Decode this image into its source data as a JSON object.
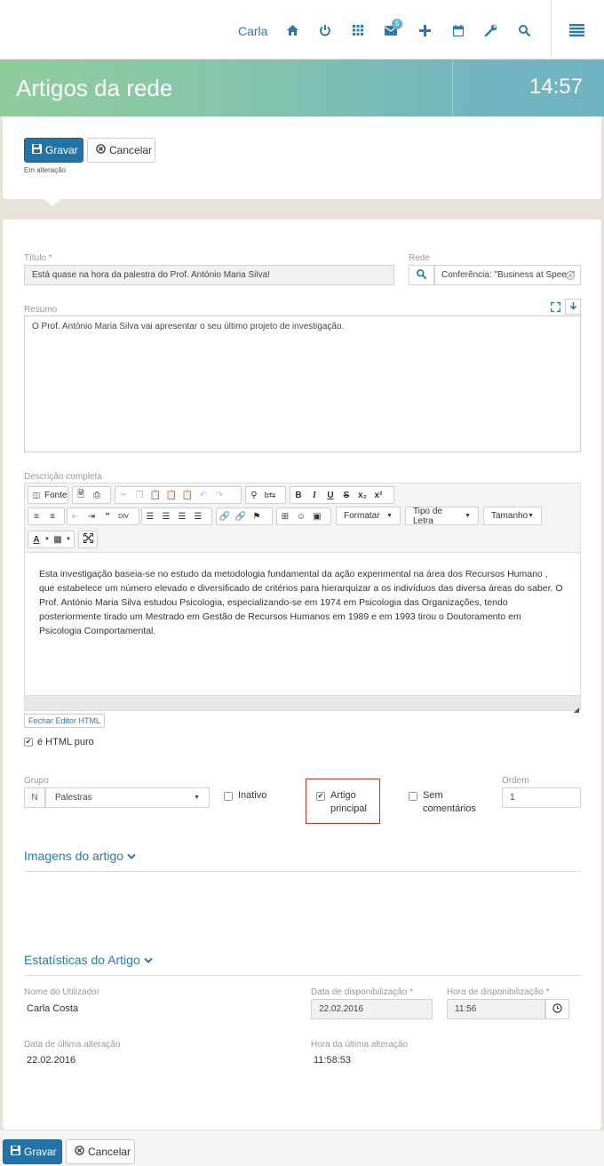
{
  "nav": {
    "user": "Carla",
    "badge_count": "5",
    "icons": [
      "home-icon",
      "power-icon",
      "grid-icon",
      "envelope-icon",
      "plus-icon",
      "calendar-icon",
      "wrench-icon",
      "search-icon",
      "menu-icon"
    ]
  },
  "banner": {
    "title": "Artigos da rede",
    "time": "14:57"
  },
  "actions": {
    "save": "Gravar",
    "cancel": "Cancelar",
    "status": "Em alteração"
  },
  "form": {
    "titulo_label": "Título *",
    "titulo_value": "Está quase na hora da palestra do Prof. António Maria Silva!",
    "rede_label": "Rede",
    "rede_value": "Conferência: \"Business at Speed\"",
    "resumo_label": "Resumo",
    "resumo_value": "O Prof. António Maria Silva vai apresentar o seu último projeto de investigação.",
    "descricao_label": "Descrição completa",
    "editor": {
      "fonte": "Fonte",
      "formatar": "Formatar",
      "tipo_letra": "Tipo de Letra",
      "tamanho": "Tamanho",
      "content": "Esta investigação baseia-se no estudo da metodologia fundamental da ação experimental na área dos Recursos Humano , que estabelece um número elevado e diversificado de critérios para hierarquizar a os indivíduos das diversa áreas do saber. O Prof. António Maria Silva estudou Psicologia, especializando-se em 1974 em Psicologia das Organizações, tendo posteriormente tirado um Mestrado em Gestão de Recursos Humanos em 1989 e em 1993 tirou o Doutoramento em Psicologia Comportamental."
    },
    "fechar_editor": "Fechar Editor HTML",
    "html_puro": "é HTML puro",
    "grupo_label": "Grupo",
    "grupo_prefix": "N",
    "grupo_value": "Palestras",
    "inativo": "Inativo",
    "artigo_principal_1": "Artigo",
    "artigo_principal_2": "principal",
    "sem_comentarios_1": "Sem",
    "sem_comentarios_2": "comentários",
    "ordem_label": "Ordem",
    "ordem_value": "1"
  },
  "imagens": {
    "title": "Imagens do artigo"
  },
  "estatisticas": {
    "title": "Estatísticas do Artigo",
    "nome_label": "Nome do Utilizador",
    "nome_value": "Carla Costa",
    "data_disp_label": "Data de disponibilização *",
    "data_disp_value": "22.02.2016",
    "hora_disp_label": "Hora de disponibilização *",
    "hora_disp_value": "11:56",
    "data_alt_label": "Data de última alteração",
    "data_alt_value": "22.02.2016",
    "hora_alt_label": "Hora da última alteração",
    "hora_alt_value": "11:58:53"
  },
  "colors": {
    "accent": "#2373a7",
    "link": "#2a7ab0",
    "highlight": "#c9302c"
  }
}
